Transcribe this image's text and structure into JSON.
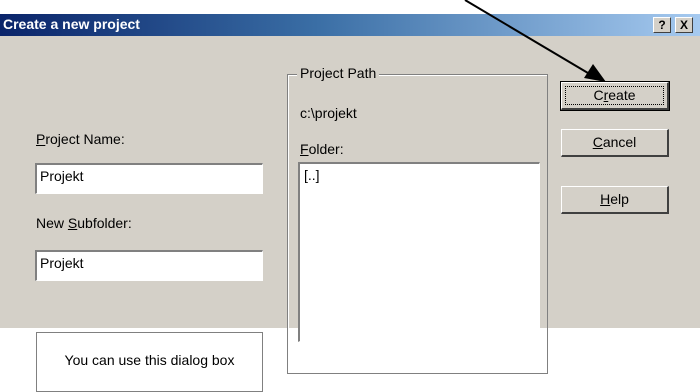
{
  "window": {
    "title": "Create a new project",
    "help_button": "?",
    "close_button": "X"
  },
  "form": {
    "project_name_label_first": "P",
    "project_name_label_rest": "roject Name:",
    "project_name_value": "Projekt",
    "subfolder_label_prefix": "New ",
    "subfolder_label_mnemonic": "S",
    "subfolder_label_rest": "ubfolder:",
    "subfolder_value": "Projekt",
    "info_text": "You can use this dialog box"
  },
  "project_path": {
    "group_title": "Project Path",
    "path": "c:\\projekt",
    "folder_label_mnemonic": "F",
    "folder_label_rest": "older:",
    "folder_items": [
      "[..]"
    ]
  },
  "buttons": {
    "create_prefix": "C",
    "create_mnemonic": "r",
    "create_rest": "eate",
    "cancel_mnemonic": "C",
    "cancel_rest": "ancel",
    "help_mnemonic": "H",
    "help_rest": "elp"
  }
}
